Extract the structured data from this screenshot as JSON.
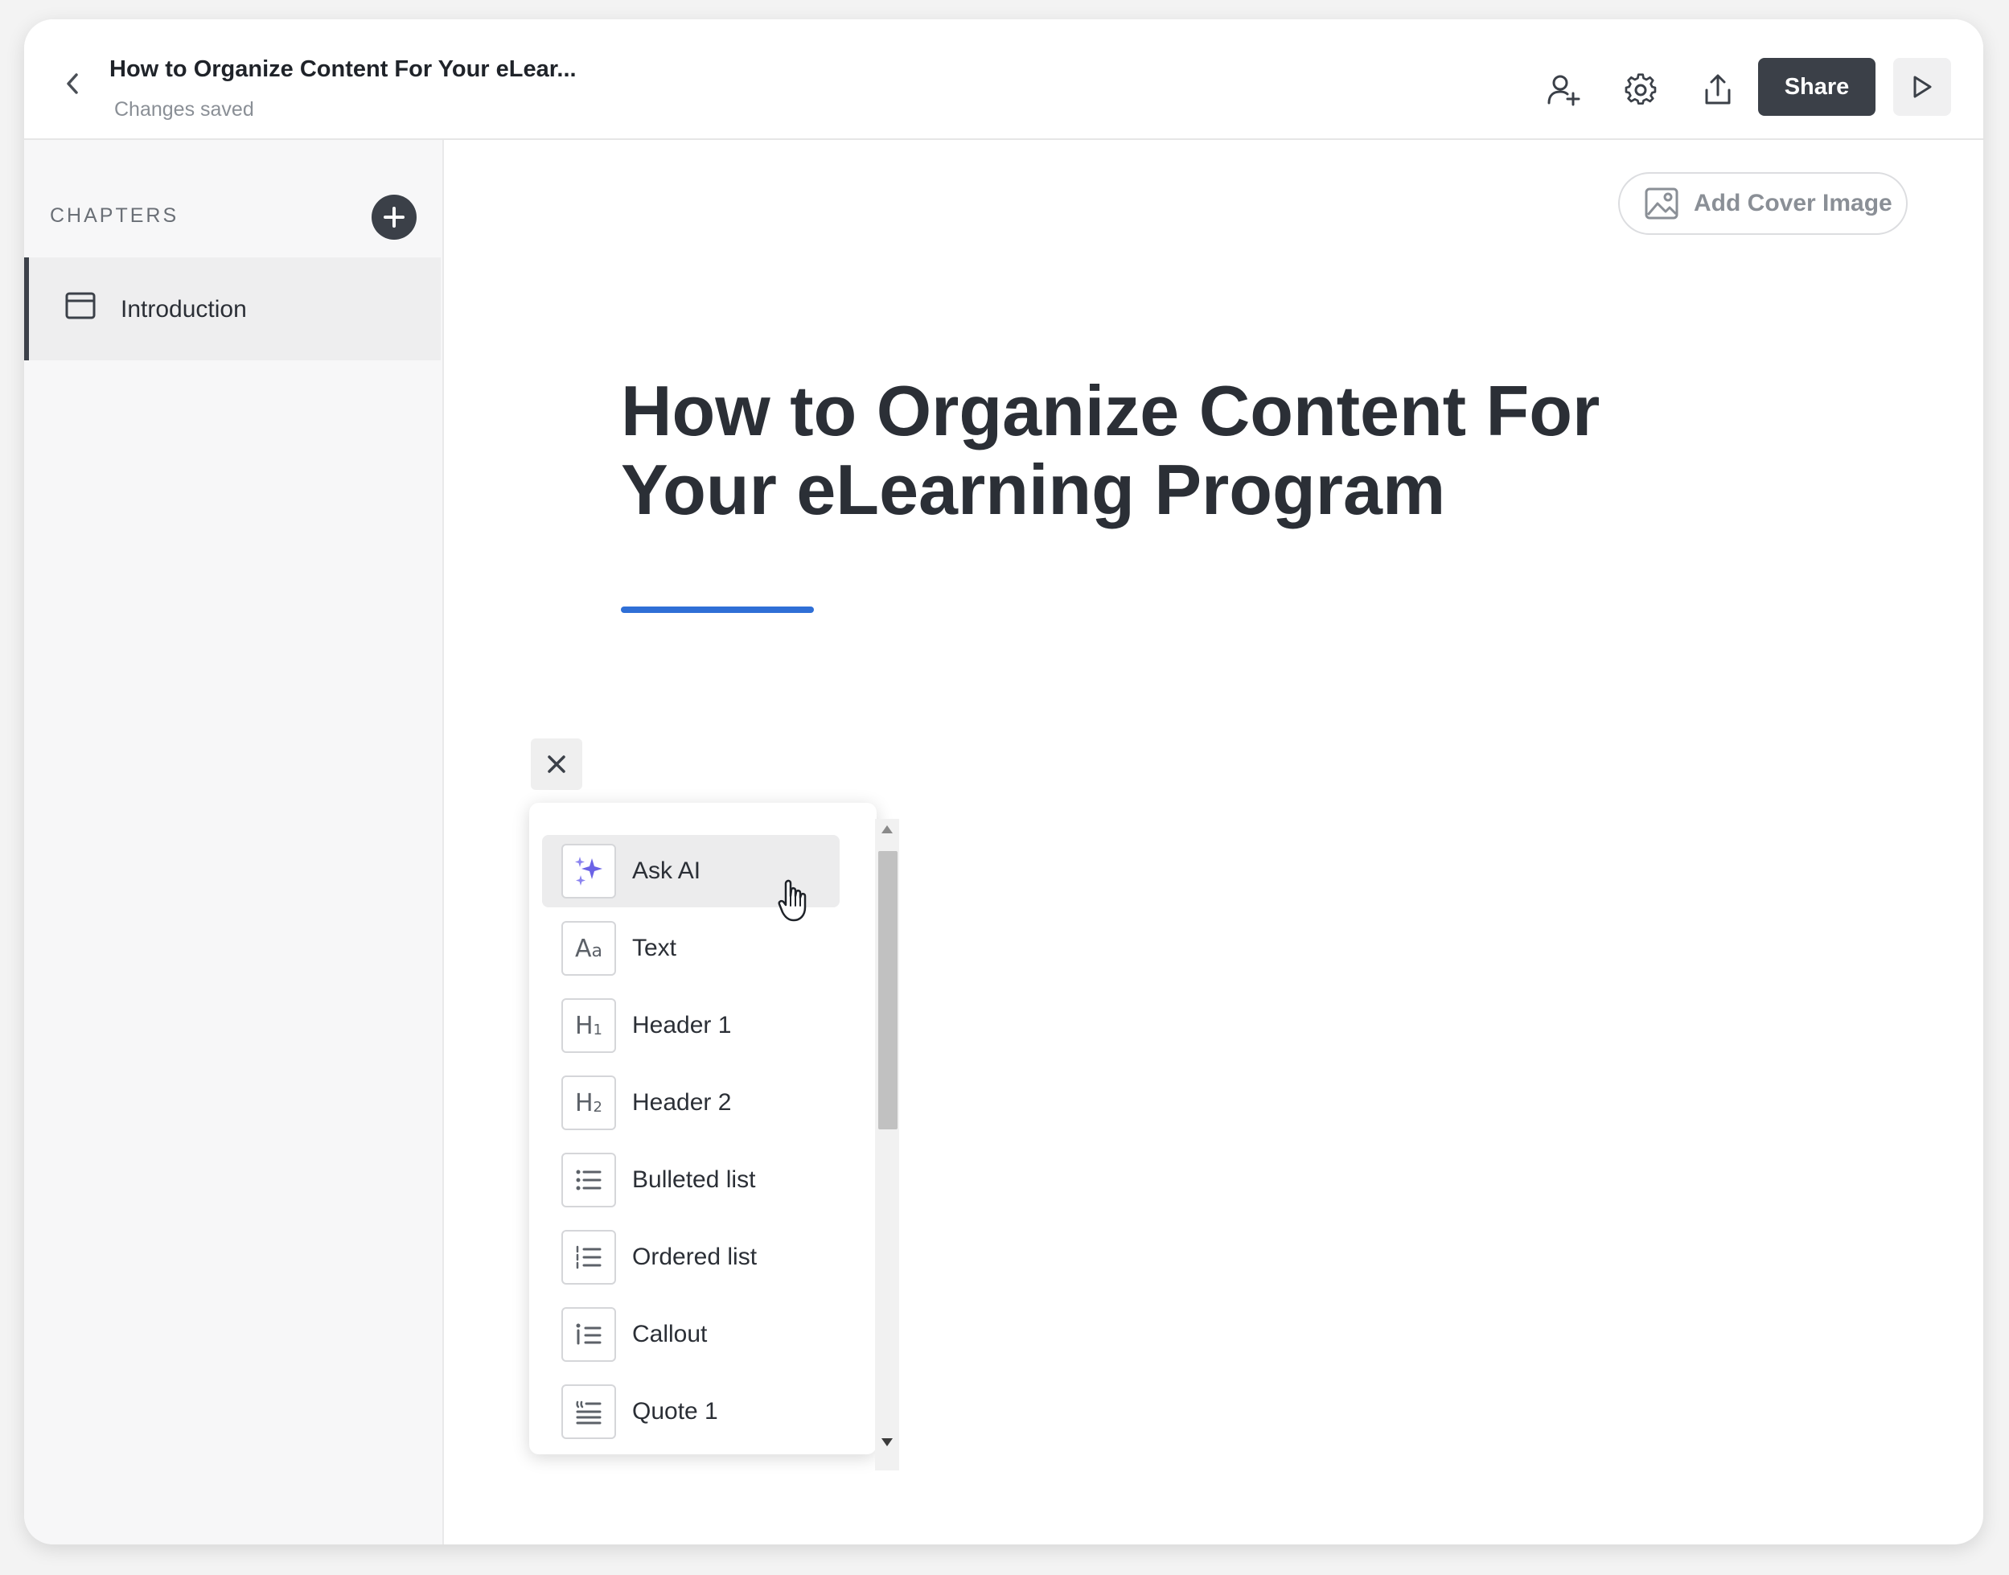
{
  "header": {
    "title": "How to Organize Content For Your eLear...",
    "status": "Changes saved",
    "share_label": "Share",
    "icons": [
      "back-chevron-icon",
      "add-collaborator-icon",
      "settings-gear-icon",
      "export-icon",
      "play-icon"
    ]
  },
  "sidebar": {
    "section_label": "CHAPTERS",
    "chapters": [
      {
        "label": "Introduction",
        "icon": "chapter-card-icon"
      }
    ]
  },
  "editor": {
    "cover_image_label": "Add Cover Image",
    "title": "How to Organize Content For Your eLearning Program",
    "accent_color": "#2f6fd6"
  },
  "block_menu": {
    "items": [
      {
        "label": "Ask AI",
        "icon": "sparkle-icon"
      },
      {
        "label": "Text",
        "icon": "text-icon"
      },
      {
        "label": "Header 1",
        "icon": "header-1-icon"
      },
      {
        "label": "Header 2",
        "icon": "header-2-icon"
      },
      {
        "label": "Bulleted list",
        "icon": "bulleted-list-icon"
      },
      {
        "label": "Ordered list",
        "icon": "ordered-list-icon"
      },
      {
        "label": "Callout",
        "icon": "callout-icon"
      },
      {
        "label": "Quote 1",
        "icon": "quote-icon"
      }
    ]
  }
}
